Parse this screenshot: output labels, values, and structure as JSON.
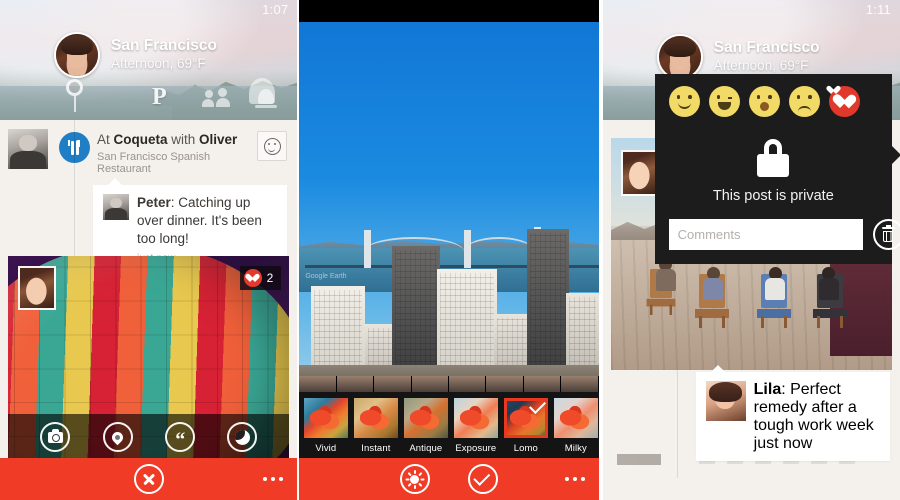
{
  "app": {
    "accent_red": "#f03b26",
    "overlay_bg": "#1c1c1c",
    "feed_bg": "#f4f0ec"
  },
  "panel_left": {
    "status": {
      "clock": "1:07"
    },
    "header": {
      "location": "San Francisco",
      "weather": "Afternoon, 69°F",
      "avatar_name": "user-avatar",
      "icons": [
        {
          "name": "map-pin-icon",
          "label": "pin"
        },
        {
          "name": "pinterest-icon",
          "label": "P"
        },
        {
          "name": "people-icon",
          "label": "people"
        },
        {
          "name": "bell-icon",
          "label": "bell"
        }
      ]
    },
    "post": {
      "title_prefix": "At ",
      "place": "Coqueta",
      "title_middle": " with ",
      "person": "Oliver",
      "subtitle": "San Francisco Spanish Restaurant",
      "category_icon": "restaurant-icon",
      "reaction_button": "smiley-icon"
    },
    "comment": {
      "author": "Peter",
      "text": ": Catching up over dinner. It's been too long!",
      "timestamp": "just now"
    },
    "photo": {
      "alt": "hot-air-balloon",
      "like_count": "2",
      "actions": [
        {
          "name": "camera-icon",
          "label": "camera"
        },
        {
          "name": "location-icon",
          "label": "location"
        },
        {
          "name": "quote-icon",
          "label": "“"
        },
        {
          "name": "moon-icon",
          "label": "moon"
        }
      ]
    },
    "appbar": {
      "close_label": "close",
      "more_label": "more"
    }
  },
  "panel_mid": {
    "photo": {
      "alt": "san-francisco-bay-bridge",
      "watermark": "Google Earth"
    },
    "filters": [
      {
        "name": "Vivid",
        "selected": false
      },
      {
        "name": "Instant",
        "selected": false
      },
      {
        "name": "Antique",
        "selected": false
      },
      {
        "name": "Exposure",
        "selected": false
      },
      {
        "name": "Lomo",
        "selected": true
      },
      {
        "name": "Milky",
        "selected": false
      }
    ],
    "appbar": {
      "adjust_label": "adjust",
      "confirm_label": "confirm",
      "more_label": "more"
    }
  },
  "panel_right": {
    "status": {
      "clock": "1:11"
    },
    "header": {
      "location": "San Francisco",
      "weather": "Afternoon, 69°F"
    },
    "overlay": {
      "reactions": [
        {
          "name": "emoji-smile",
          "label": "smile"
        },
        {
          "name": "emoji-wink-laugh",
          "label": "wink"
        },
        {
          "name": "emoji-surprised",
          "label": "surprised"
        },
        {
          "name": "emoji-sad",
          "label": "sad"
        },
        {
          "name": "emoji-heart",
          "label": "heart"
        }
      ],
      "privacy_text": "This post is private",
      "comments_placeholder": "Comments",
      "comments_value": "",
      "delete_label": "delete"
    },
    "photo": {
      "alt": "rooftop-deck-friends",
      "privacy_badge": "lock-icon"
    },
    "comment": {
      "author": "Lila",
      "text": ": Perfect remedy after a tough work week",
      "timestamp": "just now"
    }
  }
}
